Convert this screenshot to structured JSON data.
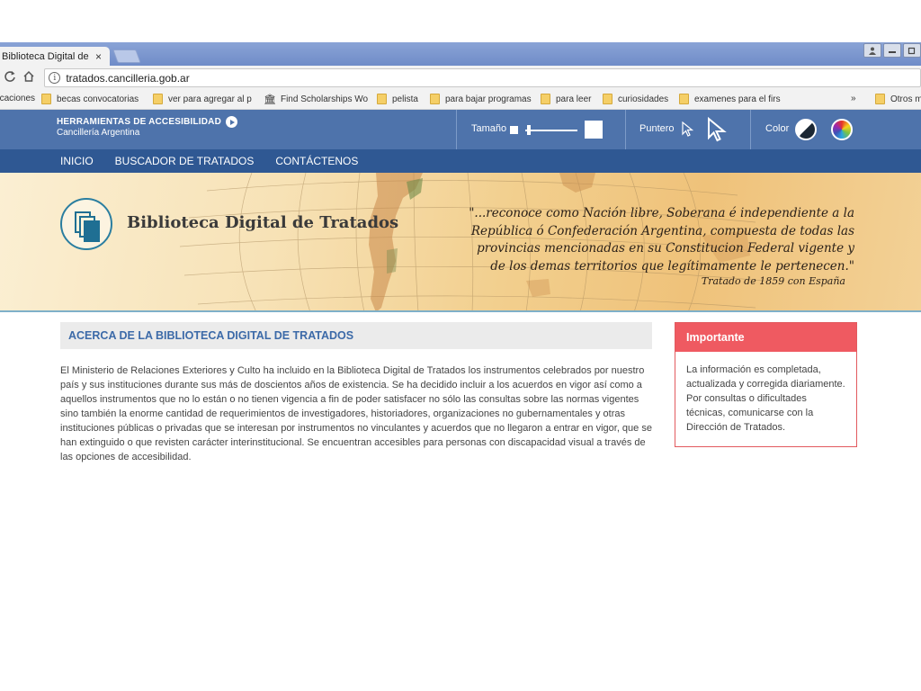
{
  "browser": {
    "tab_title": "Biblioteca Digital de Tratados",
    "tab_close": "×",
    "url": "tratados.cancilleria.gob.ar",
    "bookmarks": [
      {
        "label": "aplicaciones",
        "icon": "folder-icon"
      },
      {
        "label": "becas convocatorias",
        "icon": "folder-icon"
      },
      {
        "label": "ver para agregar al p",
        "icon": "folder-icon"
      },
      {
        "label": "Find Scholarships Wo",
        "icon": "bank-icon"
      },
      {
        "label": "pelista",
        "icon": "folder-icon"
      },
      {
        "label": "para bajar programas",
        "icon": "folder-icon"
      },
      {
        "label": "para leer",
        "icon": "folder-icon"
      },
      {
        "label": "curiosidades",
        "icon": "folder-icon"
      },
      {
        "label": "examenes para el firs",
        "icon": "folder-icon"
      }
    ],
    "bookmarks_overflow": "»",
    "other_bookmarks": "Otros marcadores"
  },
  "accessibility": {
    "title": "HERRAMIENTAS DE ACCESIBILIDAD",
    "subtitle": "Cancillería Argentina",
    "size_label": "Tamaño",
    "pointer_label": "Puntero",
    "color_label": "Color"
  },
  "nav": {
    "items": [
      "INICIO",
      "BUSCADOR DE TRATADOS",
      "CONTÁCTENOS"
    ]
  },
  "banner": {
    "title": "Biblioteca Digital de Tratados",
    "quote": "\"...reconoce como Nación libre, Soberana é independiente a la República ó Confederación Argentina, compuesta de todas las provincias mencionadas en su Constitucion Federal vigente y de los demas territorios que legítimamente le pertenecen.\"",
    "quote_source": "Tratado de 1859 con España"
  },
  "about": {
    "heading": "ACERCA DE LA BIBLIOTECA DIGITAL DE TRATADOS",
    "body": "El Ministerio de Relaciones Exteriores y Culto ha incluido en la Biblioteca Digital de Tratados los instrumentos celebrados por nuestro país y sus instituciones durante sus más de doscientos años de existencia. Se ha decidido incluir a los acuerdos en vigor así como a aquellos instrumentos que no lo están o no tienen vigencia a fin de poder satisfacer no sólo las consultas sobre las normas vigentes sino también la enorme cantidad de requerimientos de investigadores, historiadores, organizaciones no gubernamentales y otras instituciones públicas o privadas que se interesan por instrumentos no vinculantes y acuerdos que no llegaron a entrar en vigor, que se han extinguido o que revisten carácter interinstitucional. Se encuentran accesibles para personas con discapacidad visual a través de las opciones de accesibilidad."
  },
  "notice": {
    "heading": "Importante",
    "body": "La información es completada, actualizada y corregida diariamente. Por consultas o dificultades técnicas, comunicarse con la Dirección de Tratados."
  },
  "colors": {
    "accessibility_bar": "#4e73ab",
    "nav_bar": "#2f5893",
    "notice_accent": "#ef5a61",
    "heading_text": "#3c6aa8"
  }
}
